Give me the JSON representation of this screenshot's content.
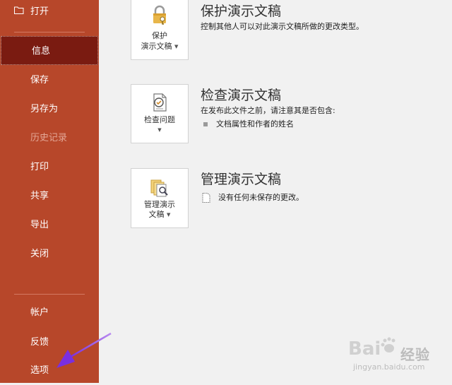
{
  "sidebar": {
    "open_label": "打开",
    "items": [
      {
        "label": "信息",
        "state": "active"
      },
      {
        "label": "保存",
        "state": "normal"
      },
      {
        "label": "另存为",
        "state": "normal"
      },
      {
        "label": "历史记录",
        "state": "disabled"
      },
      {
        "label": "打印",
        "state": "normal"
      },
      {
        "label": "共享",
        "state": "normal"
      },
      {
        "label": "导出",
        "state": "normal"
      },
      {
        "label": "关闭",
        "state": "normal"
      }
    ],
    "bottom_items": [
      {
        "label": "帐户"
      },
      {
        "label": "反馈"
      },
      {
        "label": "选项"
      }
    ],
    "colors": {
      "bg": "#b7472a",
      "active": "#7a1b11"
    }
  },
  "protect": {
    "button_line1": "保护",
    "button_line2": "演示文稿",
    "title": "保护演示文稿",
    "desc": "控制其他人可以对此演示文稿所做的更改类型。"
  },
  "inspect": {
    "button_label": "检查问题",
    "title": "检查演示文稿",
    "desc": "在发布此文件之前，请注意其是否包含:",
    "bullet": "文档属性和作者的姓名"
  },
  "manage": {
    "button_line1": "管理演示",
    "button_line2": "文稿",
    "title": "管理演示文稿",
    "desc": "没有任何未保存的更改。"
  },
  "watermark": {
    "brand": "经验",
    "sub": "jingyan.baidu.com"
  }
}
